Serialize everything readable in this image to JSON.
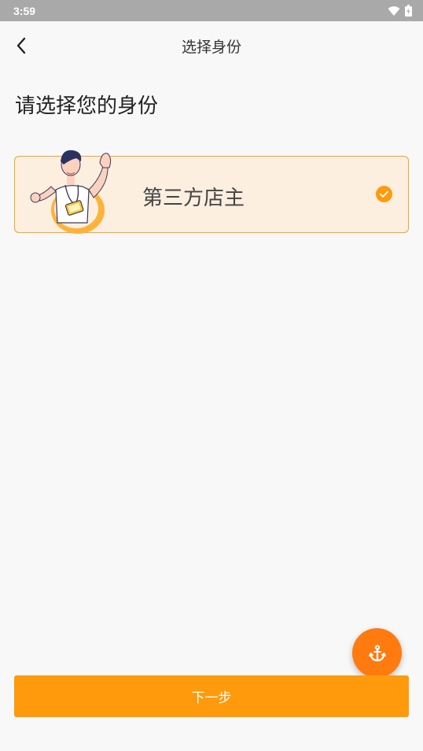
{
  "status_bar": {
    "time": "3:59",
    "icons": [
      "wifi-icon",
      "battery-icon"
    ]
  },
  "nav": {
    "title": "选择身份",
    "back_icon": "chevron-left-icon"
  },
  "heading": "请选择您的身份",
  "roles": [
    {
      "label": "第三方店主",
      "selected": true,
      "icon": "check-circle-icon",
      "illustration": "shopkeeper-illustration"
    }
  ],
  "fab": {
    "icon": "anchor-icon"
  },
  "next_button": {
    "label": "下一步"
  },
  "colors": {
    "accent": "#ff9a0c",
    "fab": "#ff7a0f",
    "card_bg": "#fcefe0",
    "card_border": "#f5a524",
    "status_bar": "#a9a9a9"
  }
}
